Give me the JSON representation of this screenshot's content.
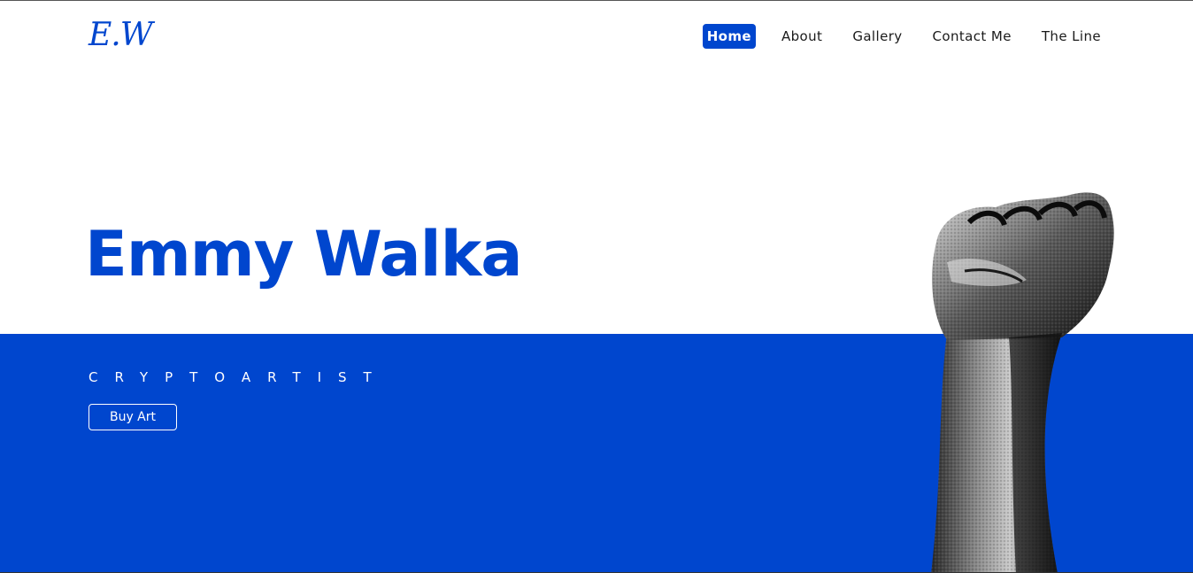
{
  "header": {
    "logo_text": "E.W",
    "nav": [
      {
        "label": "Home",
        "active": true
      },
      {
        "label": "About",
        "active": false
      },
      {
        "label": "Gallery",
        "active": false
      },
      {
        "label": "Contact Me",
        "active": false
      },
      {
        "label": "The Line",
        "active": false
      }
    ]
  },
  "hero": {
    "title": "Emmy Walka",
    "subtitle": "CRYPTOARTIST",
    "cta_label": "Buy Art",
    "image": "raised-fist-image"
  },
  "colors": {
    "accent": "#0046ce",
    "background": "#ffffff",
    "nav_text": "#1a1a1a"
  }
}
